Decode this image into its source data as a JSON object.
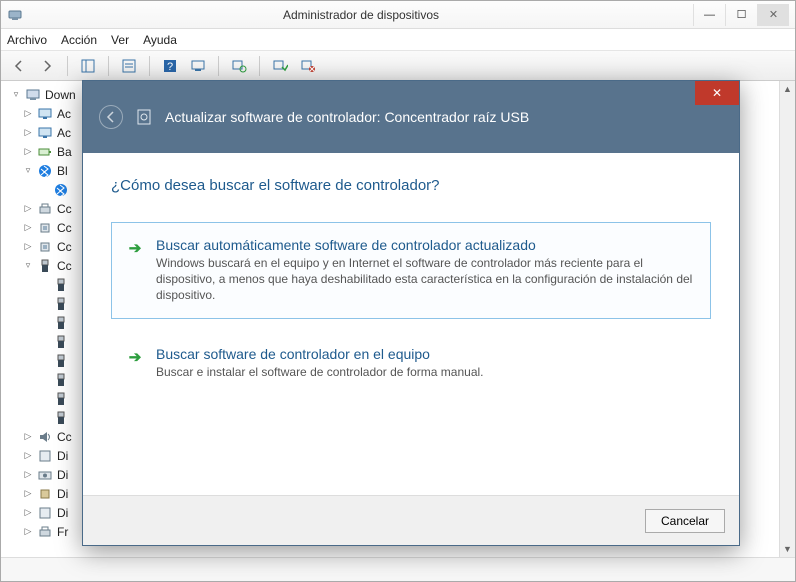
{
  "window": {
    "title": "Administrador de dispositivos"
  },
  "menu": {
    "file": "Archivo",
    "action": "Acción",
    "view": "Ver",
    "help": "Ayuda"
  },
  "tree": {
    "root": "Down",
    "items": [
      {
        "indent": 1,
        "tri": "▷",
        "icon": "display",
        "label": "Ac"
      },
      {
        "indent": 1,
        "tri": "▷",
        "icon": "display",
        "label": "Ac"
      },
      {
        "indent": 1,
        "tri": "▷",
        "icon": "battery",
        "label": "Ba"
      },
      {
        "indent": 1,
        "tri": "▿",
        "icon": "bluetooth",
        "label": "Bl"
      },
      {
        "indent": 2,
        "tri": "",
        "icon": "bluetooth",
        "label": ""
      },
      {
        "indent": 1,
        "tri": "▷",
        "icon": "printer",
        "label": "Cc"
      },
      {
        "indent": 1,
        "tri": "▷",
        "icon": "cpu",
        "label": "Cc"
      },
      {
        "indent": 1,
        "tri": "▷",
        "icon": "cpu",
        "label": "Cc"
      },
      {
        "indent": 1,
        "tri": "▿",
        "icon": "usb",
        "label": "Cc"
      },
      {
        "indent": 2,
        "tri": "",
        "icon": "usb",
        "label": ""
      },
      {
        "indent": 2,
        "tri": "",
        "icon": "usb",
        "label": ""
      },
      {
        "indent": 2,
        "tri": "",
        "icon": "usb",
        "label": ""
      },
      {
        "indent": 2,
        "tri": "",
        "icon": "usb",
        "label": ""
      },
      {
        "indent": 2,
        "tri": "",
        "icon": "usb",
        "label": ""
      },
      {
        "indent": 2,
        "tri": "",
        "icon": "usb",
        "label": ""
      },
      {
        "indent": 2,
        "tri": "",
        "icon": "usb",
        "label": ""
      },
      {
        "indent": 2,
        "tri": "",
        "icon": "usb",
        "label": ""
      },
      {
        "indent": 1,
        "tri": "▷",
        "icon": "speaker",
        "label": "Cc"
      },
      {
        "indent": 1,
        "tri": "▷",
        "icon": "device",
        "label": "Di"
      },
      {
        "indent": 1,
        "tri": "▷",
        "icon": "camera",
        "label": "Di"
      },
      {
        "indent": 1,
        "tri": "▷",
        "icon": "chip",
        "label": "Di"
      },
      {
        "indent": 1,
        "tri": "▷",
        "icon": "device",
        "label": "Di"
      },
      {
        "indent": 1,
        "tri": "▷",
        "icon": "printer",
        "label": "Fr"
      }
    ]
  },
  "dialog": {
    "title": "Actualizar software de controlador: Concentrador raíz USB",
    "question": "¿Cómo desea buscar el software de controlador?",
    "option1": {
      "title": "Buscar automáticamente software de controlador actualizado",
      "desc": "Windows buscará en el equipo y en Internet el software de controlador más reciente para el dispositivo, a menos que haya deshabilitado esta característica en la configuración de instalación del dispositivo."
    },
    "option2": {
      "title": "Buscar software de controlador en el equipo",
      "desc": "Buscar e instalar el software de controlador de forma manual."
    },
    "cancel": "Cancelar"
  }
}
